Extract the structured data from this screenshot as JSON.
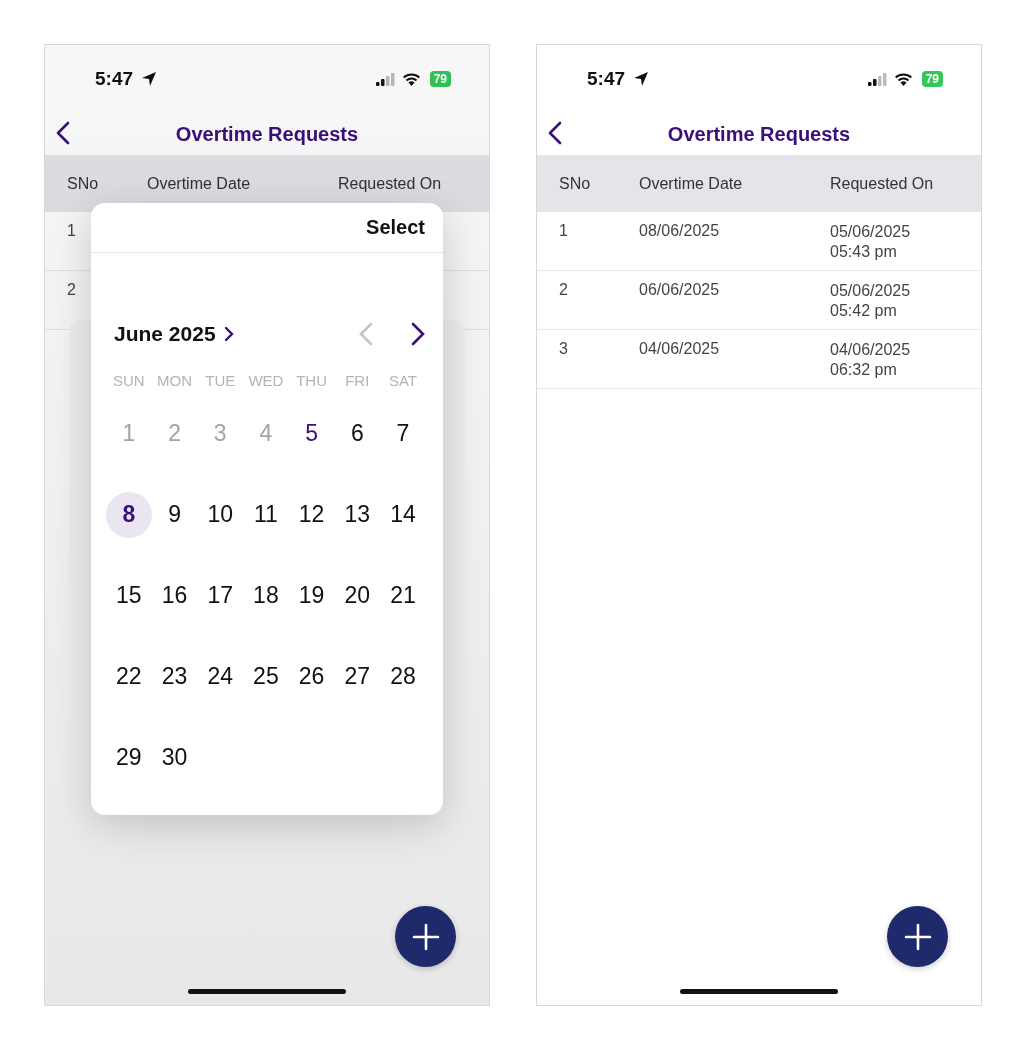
{
  "screens": [
    {
      "status_bar": {
        "time": "5:47",
        "battery": "79"
      },
      "header": {
        "title": "Overtime Requests"
      },
      "table": {
        "columns": [
          "SNo",
          "Overtime Date",
          "Requested On"
        ],
        "rows": [
          {
            "sno": "1"
          },
          {
            "sno": "2"
          }
        ]
      },
      "date_picker": {
        "action": "Select",
        "month": "June 2025",
        "prev_month": {
          "disabled": true
        },
        "next_month": {
          "disabled": false
        },
        "weekdays": [
          "SUN",
          "MON",
          "TUE",
          "WED",
          "THU",
          "FRI",
          "SAT"
        ],
        "days": [
          {
            "label": "1",
            "disabled": true,
            "today": false,
            "selected": false
          },
          {
            "label": "2",
            "disabled": true,
            "today": false,
            "selected": false
          },
          {
            "label": "3",
            "disabled": true,
            "today": false,
            "selected": false
          },
          {
            "label": "4",
            "disabled": true,
            "today": false,
            "selected": false
          },
          {
            "label": "5",
            "disabled": false,
            "today": true,
            "selected": false
          },
          {
            "label": "6",
            "disabled": false,
            "today": false,
            "selected": false
          },
          {
            "label": "7",
            "disabled": false,
            "today": false,
            "selected": false
          },
          {
            "label": "8",
            "disabled": false,
            "today": false,
            "selected": true
          },
          {
            "label": "9",
            "disabled": false,
            "today": false,
            "selected": false
          },
          {
            "label": "10",
            "disabled": false,
            "today": false,
            "selected": false
          },
          {
            "label": "11",
            "disabled": false,
            "today": false,
            "selected": false
          },
          {
            "label": "12",
            "disabled": false,
            "today": false,
            "selected": false
          },
          {
            "label": "13",
            "disabled": false,
            "today": false,
            "selected": false
          },
          {
            "label": "14",
            "disabled": false,
            "today": false,
            "selected": false
          },
          {
            "label": "15",
            "disabled": false,
            "today": false,
            "selected": false
          },
          {
            "label": "16",
            "disabled": false,
            "today": false,
            "selected": false
          },
          {
            "label": "17",
            "disabled": false,
            "today": false,
            "selected": false
          },
          {
            "label": "18",
            "disabled": false,
            "today": false,
            "selected": false
          },
          {
            "label": "19",
            "disabled": false,
            "today": false,
            "selected": false
          },
          {
            "label": "20",
            "disabled": false,
            "today": false,
            "selected": false
          },
          {
            "label": "21",
            "disabled": false,
            "today": false,
            "selected": false
          },
          {
            "label": "22",
            "disabled": false,
            "today": false,
            "selected": false
          },
          {
            "label": "23",
            "disabled": false,
            "today": false,
            "selected": false
          },
          {
            "label": "24",
            "disabled": false,
            "today": false,
            "selected": false
          },
          {
            "label": "25",
            "disabled": false,
            "today": false,
            "selected": false
          },
          {
            "label": "26",
            "disabled": false,
            "today": false,
            "selected": false
          },
          {
            "label": "27",
            "disabled": false,
            "today": false,
            "selected": false
          },
          {
            "label": "28",
            "disabled": false,
            "today": false,
            "selected": false
          },
          {
            "label": "29",
            "disabled": false,
            "today": false,
            "selected": false
          },
          {
            "label": "30",
            "disabled": false,
            "today": false,
            "selected": false
          }
        ]
      }
    },
    {
      "status_bar": {
        "time": "5:47",
        "battery": "79"
      },
      "header": {
        "title": "Overtime Requests"
      },
      "table": {
        "columns": [
          "SNo",
          "Overtime Date",
          "Requested On"
        ],
        "rows": [
          {
            "sno": "1",
            "overtime_date": "08/06/2025",
            "requested_on": "05/06/2025\n05:43 pm"
          },
          {
            "sno": "2",
            "overtime_date": "06/06/2025",
            "requested_on": "05/06/2025\n05:42 pm"
          },
          {
            "sno": "3",
            "overtime_date": "04/06/2025",
            "requested_on": "04/06/2025\n06:32 pm"
          }
        ]
      }
    }
  ]
}
